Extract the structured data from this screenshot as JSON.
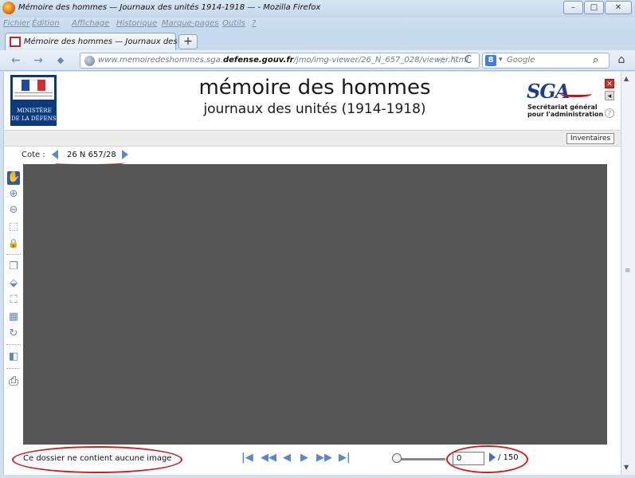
{
  "window": {
    "title": "Mémoire des hommes — Journaux des unités 1914-1918 — - Mozilla Firefox",
    "minimize": "–",
    "maximize": "□",
    "close": "✕"
  },
  "menu": [
    "Fichier",
    "Édition",
    "Affichage",
    "Historique",
    "Marque-pages",
    "Outils",
    "?"
  ],
  "tab": {
    "label": "Mémoire des hommes — Journaux des u...",
    "new_tab": "+"
  },
  "nav": {
    "back": "←",
    "forward": "→",
    "url_prefix": "www.memoiredeshommes.sga.",
    "url_domain": "defense.gouv.fr",
    "url_suffix": "/jmo/img-viewer/26_N_657_028/viewer.html",
    "search_engine_badge": "8",
    "search_placeholder": "Google",
    "star": "☆",
    "dropdown": "▽",
    "reload": "C",
    "search_icon": "⌕",
    "home": "⌂"
  },
  "header": {
    "logo_line1": "MINISTÈRE",
    "logo_line2": "DE LA DÉFENSE",
    "title": "mémoire des hommes",
    "subtitle": "journaux des unités (1914-1918)",
    "sga_logo": "SGA",
    "sga_line1": "Secrétariat général",
    "sga_line2": "pour l'administration",
    "close_icon": "✕",
    "sound_icon": "◂",
    "help_icon": "?"
  },
  "inventaires_label": "Inventaires",
  "cote": {
    "label": "Cote :",
    "value": "26 N 657/28"
  },
  "tools": {
    "hand": "✋",
    "zoom_in": "⊕",
    "zoom_out": "⊖",
    "zoom_rect": "⬚",
    "lock": "🔒",
    "pages": "❐",
    "fit": "⬙",
    "fullscreen": "⛶",
    "grid": "▦",
    "rotate": "↻",
    "layers": "◧",
    "print": "⎙"
  },
  "status": {
    "message": "Ce dossier ne contient aucune image"
  },
  "pagination": {
    "first": "|◀",
    "rewind": "◀◀",
    "prev": "◀",
    "next": "▶",
    "fast_forward": "▶▶",
    "last": "▶|",
    "current_page": "0",
    "total": "/ 150"
  },
  "accent_colors": {
    "annotation_red": "#d21b1b",
    "nav_blue": "#5d87c8",
    "viewer_gray": "#555555"
  }
}
